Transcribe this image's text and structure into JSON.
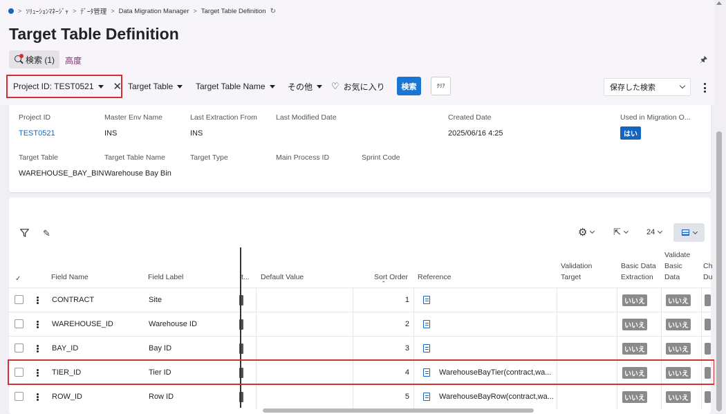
{
  "breadcrumb": {
    "items": [
      "ｿﾘｭｰｼｮﾝﾏﾈｰｼﾞｬ",
      "ﾃﾞｰﾀ管理",
      "Data Migration Manager",
      "Target Table Definition"
    ]
  },
  "page": {
    "title": "Target Table Definition",
    "search_tab": "検索 (1)",
    "advanced_tab": "高度",
    "pin_icon": "pin-icon"
  },
  "filters": {
    "project_chip": "Project ID: TEST0521",
    "target_table": "Target Table",
    "target_table_name": "Target Table Name",
    "other": "その他",
    "favorites": "お気に入り",
    "search_button": "検索",
    "clear_button": "ｸﾘｱ",
    "saved_search": "保存した検索"
  },
  "detail": {
    "labels": {
      "project_id": "Project ID",
      "master_env": "Master Env Name",
      "last_extraction": "Last Extraction From",
      "last_modified": "Last Modified Date",
      "created": "Created Date",
      "used_in_migration": "Used in Migration O...",
      "target_table": "Target Table",
      "target_table_name": "Target Table Name",
      "target_type": "Target Type",
      "main_process": "Main Process ID",
      "sprint_code": "Sprint Code"
    },
    "values": {
      "project_id": "TEST0521",
      "master_env": "INS",
      "last_extraction": "INS",
      "created": "2025/06/16 4:25",
      "used_in_migration": "はい",
      "target_table": "WAREHOUSE_BAY_BIN",
      "target_table_name": "Warehouse Bay Bin"
    }
  },
  "toolbar": {
    "page_size": "24"
  },
  "table": {
    "headers": {
      "field_name": "Field Name",
      "field_label": "Field Label",
      "truncated": "t...",
      "default_value": "Default Value",
      "sort_order": "Sort Order",
      "reference": "Reference",
      "validation_target": [
        "Validation",
        "Target"
      ],
      "basic_data_extraction": [
        "Basic Data",
        "Extraction"
      ],
      "validate_basic_data": [
        "Validate",
        "Basic",
        "Data"
      ],
      "ch": [
        "Ch",
        "Du"
      ]
    },
    "no_label": "いいえ",
    "rows": [
      {
        "field_name": "CONTRACT",
        "field_label": "Site",
        "sort_order": "1",
        "reference": ""
      },
      {
        "field_name": "WAREHOUSE_ID",
        "field_label": "Warehouse ID",
        "sort_order": "2",
        "reference": ""
      },
      {
        "field_name": "BAY_ID",
        "field_label": "Bay ID",
        "sort_order": "3",
        "reference": ""
      },
      {
        "field_name": "TIER_ID",
        "field_label": "Tier ID",
        "sort_order": "4",
        "reference": "WarehouseBayTier(contract,wa..."
      },
      {
        "field_name": "ROW_ID",
        "field_label": "Row ID",
        "sort_order": "5",
        "reference": "WarehouseBayRow(contract,wa..."
      }
    ]
  },
  "colors": {
    "accent": "#1565c0",
    "highlight": "#d32f2f",
    "no_badge": "#8a8a8a"
  }
}
